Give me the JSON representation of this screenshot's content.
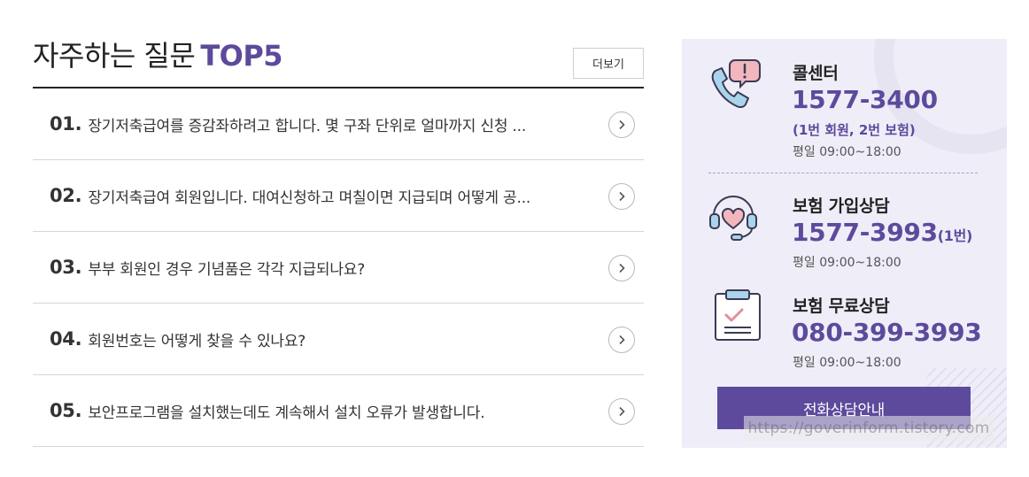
{
  "faq": {
    "title": "자주하는 질문",
    "title_accent": "TOP5",
    "more_label": "더보기",
    "items": [
      {
        "num": "01.",
        "question": "장기저축급여를 증감좌하려고 합니다. 몇 구좌 단위로 얼마까지 신청 ..."
      },
      {
        "num": "02.",
        "question": "장기저축급여 회원입니다. 대여신청하고 며칠이면 지급되며 어떻게 공..."
      },
      {
        "num": "03.",
        "question": "부부 회원인 경우 기념품은 각각 지급되나요?"
      },
      {
        "num": "04.",
        "question": "회원번호는 어떻게 찾을 수 있나요?"
      },
      {
        "num": "05.",
        "question": "보안프로그램을 설치했는데도 계속해서 설치 오류가 발생합니다."
      }
    ]
  },
  "contact": {
    "call_center": {
      "label": "콜센터",
      "phone": "1577-3400",
      "note": "(1번 회원, 2번 보험)",
      "hours": "평일 09:00~18:00"
    },
    "insurance_join": {
      "label": "보험 가입상담",
      "phone": "1577-3993",
      "phone_suffix": "(1번)",
      "hours": "평일 09:00~18:00"
    },
    "insurance_free": {
      "label": "보험 무료상담",
      "phone": "080-399-3993",
      "hours": "평일 09:00~18:00"
    },
    "button_label": "전화상담안내"
  },
  "watermark": "https://goverinform.tistory.com",
  "colors": {
    "accent": "#5d4a9c",
    "panel_bg": "#efedf7",
    "icon_pink": "#f2b7bd",
    "icon_blue": "#a9d4ec"
  }
}
